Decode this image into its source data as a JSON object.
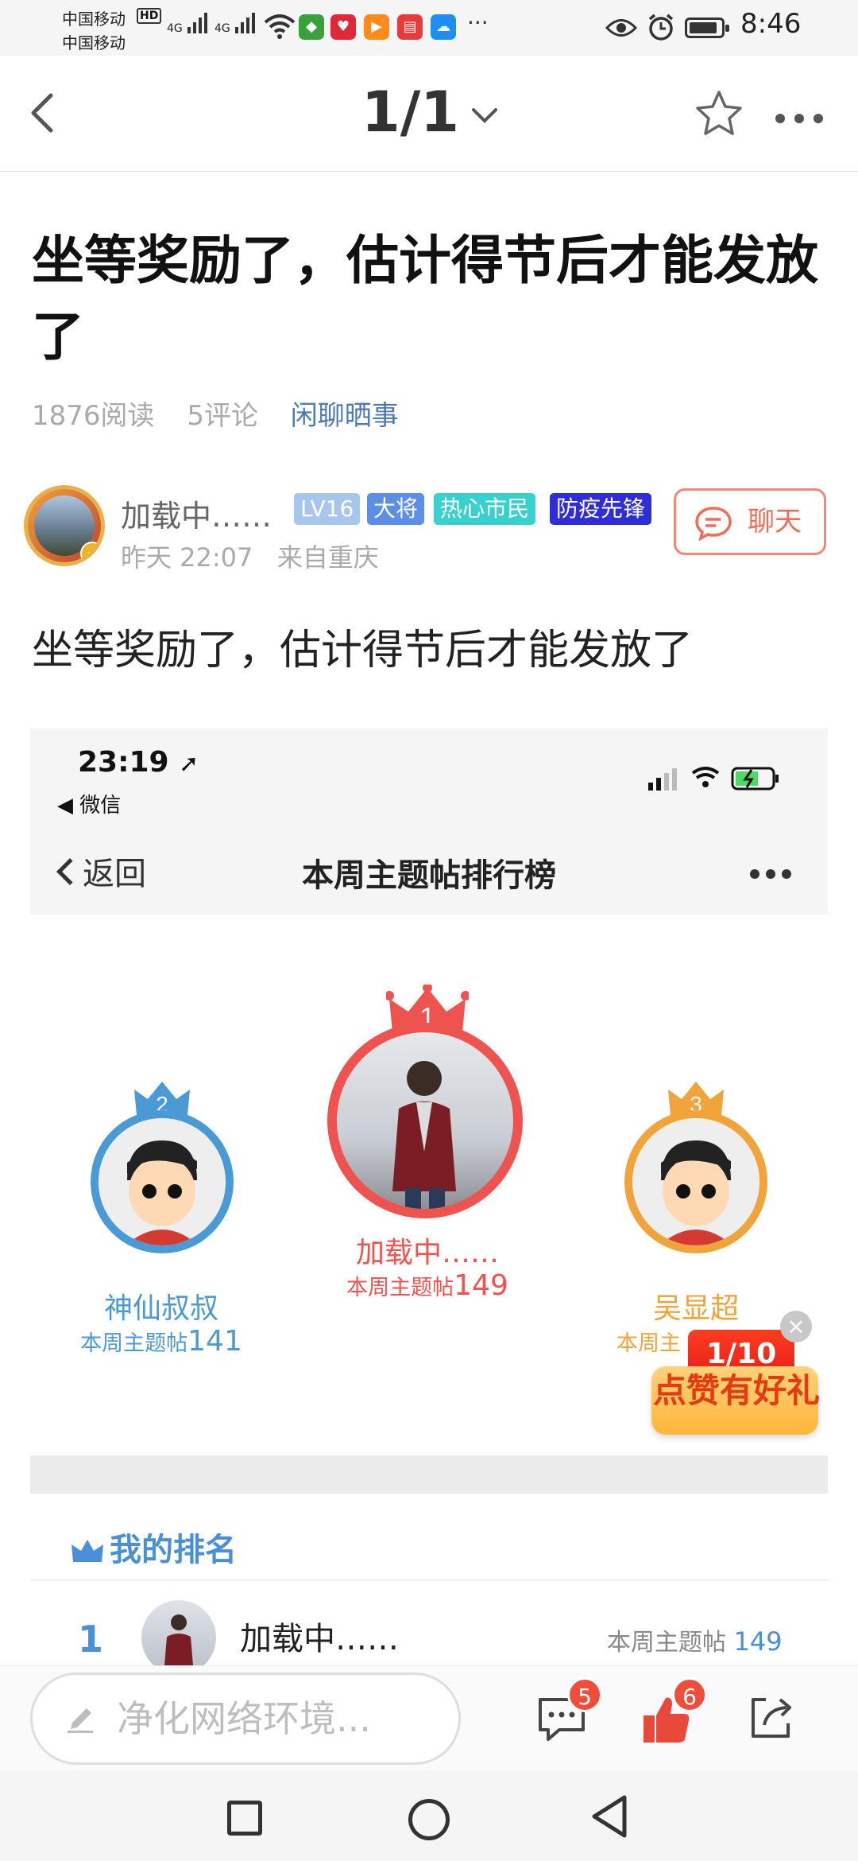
{
  "status_bar": {
    "carrier_line1": "中国移动",
    "carrier_line2": "中国移动",
    "hd": "HD",
    "net1": "4G",
    "net2": "4G",
    "more": "···",
    "time": "8:46"
  },
  "header": {
    "page_indicator": "1/1"
  },
  "post": {
    "title": "坐等奖励了，估计得节后才能发放了",
    "reads": "1876阅读",
    "comments": "5评论",
    "topic": "闲聊晒事",
    "author": "加载中……",
    "badges": {
      "level": "LV16",
      "rank": "大将",
      "citizen": "热心市民",
      "pioneer": "防疫先锋"
    },
    "time": "昨天 22:07",
    "from": "来自重庆",
    "chat_label": "聊天",
    "body": "坐等奖励了，估计得节后才能发放了"
  },
  "screenshot": {
    "time": "23:19",
    "wechat_back": "◀ 微信",
    "back_label": "返回",
    "title": "本周主题帖排行榜",
    "podium": [
      {
        "rank": "1",
        "name": "加载中……",
        "label": "本周主题帖",
        "count": "149"
      },
      {
        "rank": "2",
        "name": "神仙叔叔",
        "label": "本周主题帖",
        "count": "141"
      },
      {
        "rank": "3",
        "name": "吴显超",
        "label": "本周主",
        "count": ""
      }
    ],
    "my_rank_title": "我的排名",
    "my_rank": {
      "rank": "1",
      "name": "加载中……",
      "label": "本周主题帖",
      "count": "149"
    }
  },
  "promo": {
    "counter": "1/10",
    "text": "点赞有好礼",
    "close": "×"
  },
  "bottom_bar": {
    "input_placeholder": "净化网络环境...",
    "comment_count": "5",
    "like_count": "6"
  },
  "colors": {
    "accent_blue": "#4a90d9",
    "first_red": "#ef5350",
    "third_orange": "#f0a43a",
    "chat_orange": "#ef6e56"
  }
}
